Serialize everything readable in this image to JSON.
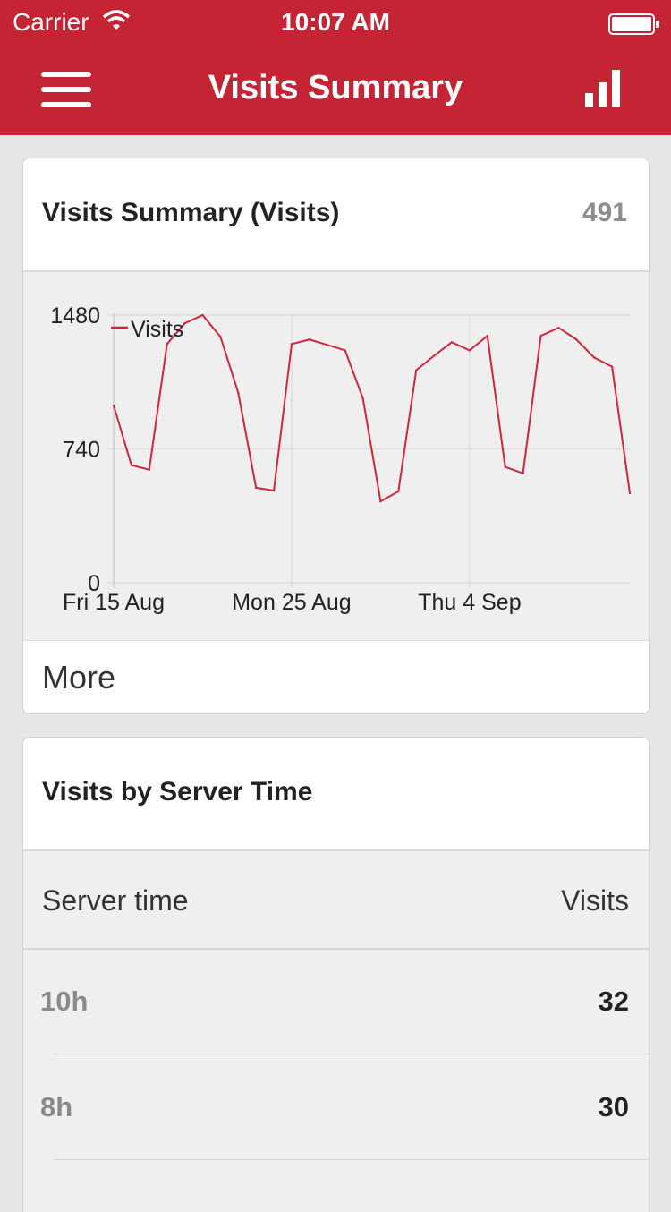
{
  "status_bar": {
    "carrier": "Carrier",
    "time": "10:07 AM"
  },
  "nav": {
    "title": "Visits Summary",
    "menu_icon": "hamburger-menu-icon",
    "chart_icon": "bar-chart-icon"
  },
  "colors": {
    "brand_red": "#c52435",
    "series_line": "#d0253a"
  },
  "summary_card": {
    "title": "Visits Summary (Visits)",
    "count": "491",
    "more_label": "More"
  },
  "chart_data": {
    "type": "line",
    "series": [
      {
        "name": "Visits",
        "x": [
          "2014-08-15",
          "2014-08-16",
          "2014-08-17",
          "2014-08-18",
          "2014-08-19",
          "2014-08-20",
          "2014-08-21",
          "2014-08-22",
          "2014-08-23",
          "2014-08-24",
          "2014-08-25",
          "2014-08-26",
          "2014-08-27",
          "2014-08-28",
          "2014-08-29",
          "2014-08-30",
          "2014-08-31",
          "2014-09-01",
          "2014-09-02",
          "2014-09-03",
          "2014-09-04",
          "2014-09-05",
          "2014-09-06",
          "2014-09-07",
          "2014-09-08",
          "2014-09-09",
          "2014-09-10",
          "2014-09-11",
          "2014-09-12",
          "2014-09-13"
        ],
        "values": [
          980,
          650,
          625,
          1320,
          1435,
          1480,
          1360,
          1050,
          525,
          510,
          1320,
          1345,
          1315,
          1285,
          1020,
          450,
          505,
          1175,
          1255,
          1330,
          1285,
          1365,
          640,
          605,
          1365,
          1410,
          1345,
          1245,
          1195,
          495
        ]
      }
    ],
    "y_ticks": [
      "0",
      "740",
      "1480"
    ],
    "x_ticks": [
      "Fri 15 Aug",
      "Mon 25 Aug",
      "Thu 4 Sep"
    ],
    "ylim": [
      0,
      1480
    ],
    "grid": true,
    "legend": "top-left"
  },
  "server_time_card": {
    "title": "Visits by Server Time",
    "column_left": "Server time",
    "column_right": "Visits",
    "rows": [
      {
        "time": "10h",
        "visits": "32"
      },
      {
        "time": "8h",
        "visits": "30"
      },
      {
        "time": "",
        "visits": ""
      }
    ]
  }
}
